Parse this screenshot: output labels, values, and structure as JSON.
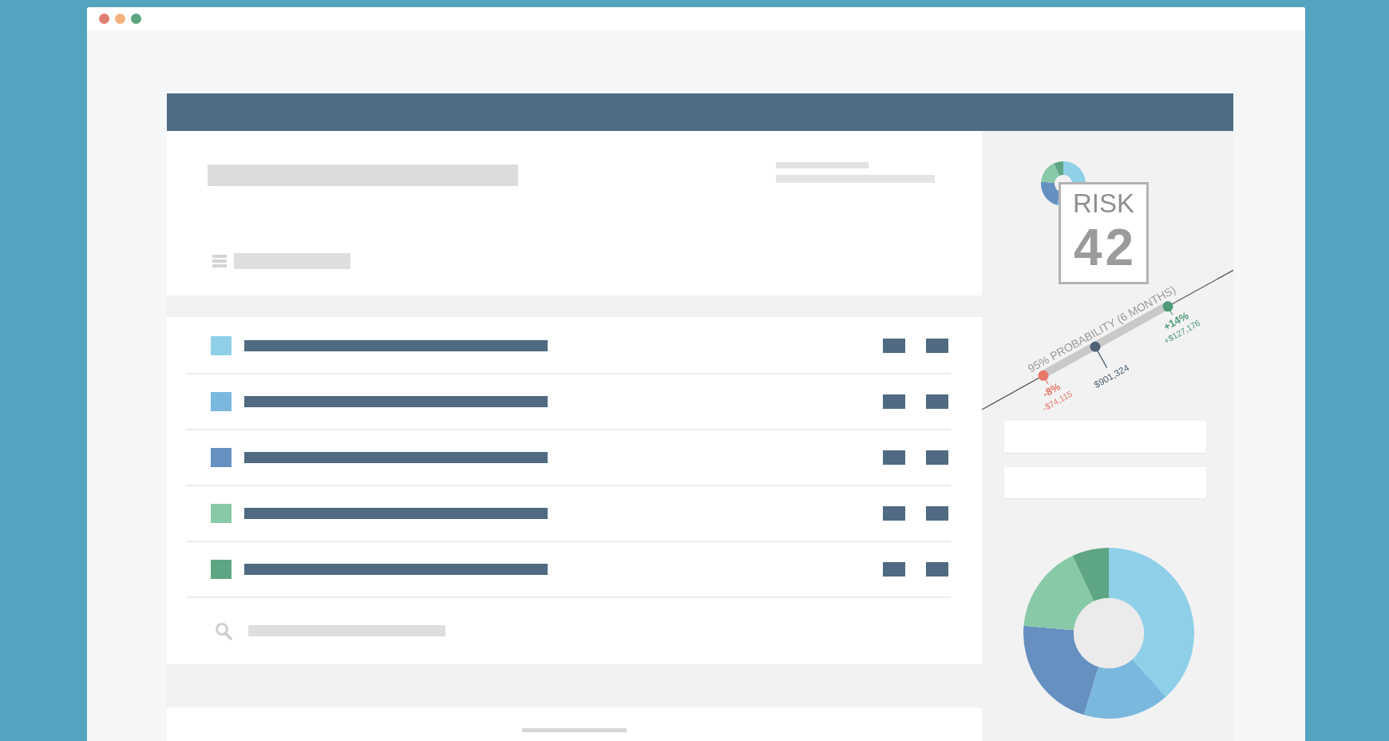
{
  "risk_badge": {
    "label": "RISK",
    "score": "42"
  },
  "probability": {
    "title": "95% PROBABILITY (6 MONTHS)",
    "markers": [
      {
        "kind": "bound",
        "color": "#e8786a",
        "percent": "-8%",
        "amount": "-$74,115"
      },
      {
        "kind": "estimate",
        "color": "#4f6274",
        "amount": "$901,324"
      },
      {
        "kind": "bound",
        "color": "#4f9a78",
        "percent": "+14%",
        "amount": "+$127,176"
      }
    ]
  },
  "rows": [
    {
      "color": "#8fd0e8"
    },
    {
      "color": "#7ab8de"
    },
    {
      "color": "#6590c0"
    },
    {
      "color": "#88c9a8"
    },
    {
      "color": "#5ea583"
    }
  ]
}
